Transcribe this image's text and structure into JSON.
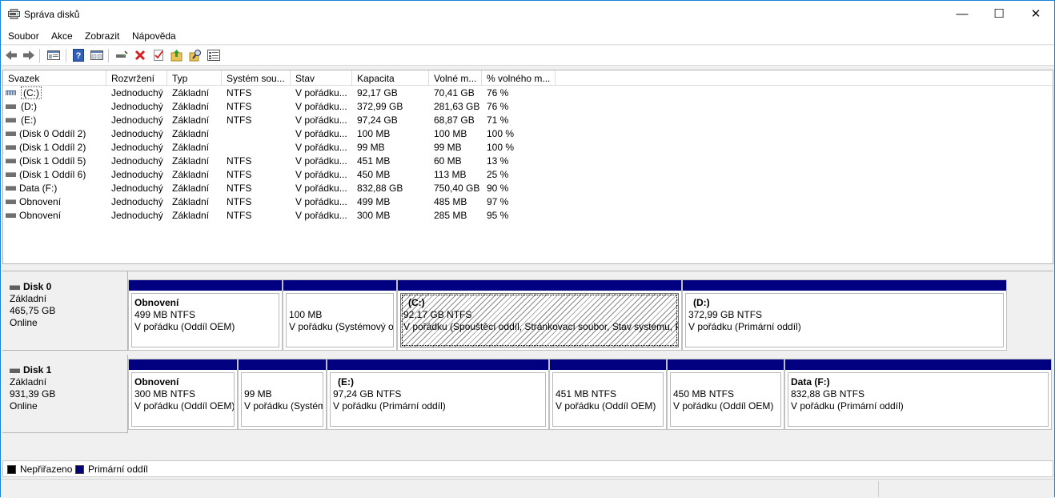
{
  "window": {
    "title": "Správa disků"
  },
  "titlebar": {
    "minimize": "—",
    "maximize": "☐",
    "close": "✕"
  },
  "menu": {
    "file": "Soubor",
    "action": "Akce",
    "view": "Zobrazit",
    "help": "Nápověda"
  },
  "toolbar": {
    "icons": [
      "back-arrow-icon",
      "forward-arrow-icon",
      "properties-pane-icon",
      "help-icon",
      "console-tree-icon",
      "connect-disk-icon",
      "delete-icon",
      "checklist-icon",
      "up-folder-icon",
      "search-folder-icon",
      "list-view-icon"
    ]
  },
  "columns": {
    "volume": "Svazek",
    "layout": "Rozvržení",
    "type": "Typ",
    "filesystem": "Systém sou...",
    "status": "Stav",
    "capacity": "Kapacita",
    "free": "Volné m...",
    "pct_free": "% volného m..."
  },
  "volumes": [
    {
      "name": "(C:)",
      "layout": "Jednoduchý",
      "type": "Základní",
      "fs": "NTFS",
      "status": "V pořádku...",
      "capacity": "92,17 GB",
      "free": "70,41 GB",
      "pct": "76 %"
    },
    {
      "name": "(D:)",
      "layout": "Jednoduchý",
      "type": "Základní",
      "fs": "NTFS",
      "status": "V pořádku...",
      "capacity": "372,99 GB",
      "free": "281,63 GB",
      "pct": "76 %"
    },
    {
      "name": "(E:)",
      "layout": "Jednoduchý",
      "type": "Základní",
      "fs": "NTFS",
      "status": "V pořádku...",
      "capacity": "97,24 GB",
      "free": "68,87 GB",
      "pct": "71 %"
    },
    {
      "name": "(Disk 0 Oddíl 2)",
      "layout": "Jednoduchý",
      "type": "Základní",
      "fs": "",
      "status": "V pořádku...",
      "capacity": "100 MB",
      "free": "100 MB",
      "pct": "100 %"
    },
    {
      "name": "(Disk 1 Oddíl 2)",
      "layout": "Jednoduchý",
      "type": "Základní",
      "fs": "",
      "status": "V pořádku...",
      "capacity": "99 MB",
      "free": "99 MB",
      "pct": "100 %"
    },
    {
      "name": "(Disk 1 Oddíl 5)",
      "layout": "Jednoduchý",
      "type": "Základní",
      "fs": "NTFS",
      "status": "V pořádku...",
      "capacity": "451 MB",
      "free": "60 MB",
      "pct": "13 %"
    },
    {
      "name": "(Disk 1 Oddíl 6)",
      "layout": "Jednoduchý",
      "type": "Základní",
      "fs": "NTFS",
      "status": "V pořádku...",
      "capacity": "450 MB",
      "free": "113 MB",
      "pct": "25 %"
    },
    {
      "name": "Data (F:)",
      "layout": "Jednoduchý",
      "type": "Základní",
      "fs": "NTFS",
      "status": "V pořádku...",
      "capacity": "832,88 GB",
      "free": "750,40 GB",
      "pct": "90 %"
    },
    {
      "name": "Obnovení",
      "layout": "Jednoduchý",
      "type": "Základní",
      "fs": "NTFS",
      "status": "V pořádku...",
      "capacity": "499 MB",
      "free": "485 MB",
      "pct": "97 %"
    },
    {
      "name": "Obnovení",
      "layout": "Jednoduchý",
      "type": "Základní",
      "fs": "NTFS",
      "status": "V pořádku...",
      "capacity": "300 MB",
      "free": "285 MB",
      "pct": "95 %"
    }
  ],
  "disks": [
    {
      "name": "Disk 0",
      "kind": "Základní",
      "size": "465,75 GB",
      "state": "Online",
      "partitions": [
        {
          "title": "Obnovení",
          "line1": "499 MB NTFS",
          "line2": "V pořádku (Oddíl OEM)"
        },
        {
          "title": "",
          "line1": "100 MB",
          "line2": "V pořádku (Systémový o"
        },
        {
          "title": "(C:)",
          "line1": "92,17 GB NTFS",
          "line2": "V pořádku (Spouštěcí oddíl, Stránkovací soubor, Stav systému, Pr"
        },
        {
          "title": "(D:)",
          "line1": "372,99 GB NTFS",
          "line2": "V pořádku (Primární oddíl)"
        }
      ]
    },
    {
      "name": "Disk 1",
      "kind": "Základní",
      "size": "931,39 GB",
      "state": "Online",
      "partitions": [
        {
          "title": "Obnovení",
          "line1": "300 MB NTFS",
          "line2": "V pořádku (Oddíl OEM)"
        },
        {
          "title": "",
          "line1": "99 MB",
          "line2": "V pořádku (Systém"
        },
        {
          "title": "(E:)",
          "line1": "97,24 GB NTFS",
          "line2": "V pořádku (Primární oddíl)"
        },
        {
          "title": "",
          "line1": "451 MB NTFS",
          "line2": "V pořádku (Oddíl OEM)"
        },
        {
          "title": "",
          "line1": "450 MB NTFS",
          "line2": "V pořádku (Oddíl OEM)"
        },
        {
          "title": "Data  (F:)",
          "line1": "832,88 GB NTFS",
          "line2": "V pořádku (Primární oddíl)"
        }
      ]
    }
  ],
  "legend": {
    "unallocated": "Nepřiřazeno",
    "primary": "Primární oddíl"
  },
  "colors": {
    "primary_partition": "#000080",
    "unallocated": "#000000",
    "window_border": "#1883d7"
  }
}
